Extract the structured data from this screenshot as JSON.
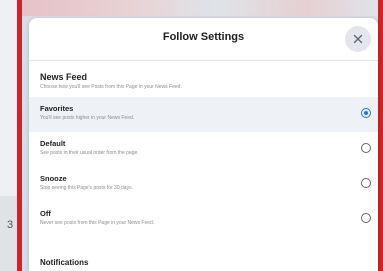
{
  "background": {
    "left_partial_text": "3"
  },
  "dialog": {
    "title": "Follow Settings",
    "close_icon": "close-icon",
    "news_feed": {
      "title": "News Feed",
      "description": "Choose how you'll see Posts from this Page in your News Feed."
    },
    "options": [
      {
        "label": "Favorites",
        "description": "You'll see posts higher in your News Feed.",
        "selected": true
      },
      {
        "label": "Default",
        "description": "See posts in their usual order from the page.",
        "selected": false
      },
      {
        "label": "Snooze",
        "description": "Stop seeing this Page's posts for 30 days.",
        "selected": false
      },
      {
        "label": "Off",
        "description": "Never see posts from this Page in your News Feed.",
        "selected": false
      }
    ],
    "notifications": {
      "title": "Notifications"
    }
  },
  "colors": {
    "frame_red": "#c9252c",
    "accent_blue": "#1877f2",
    "selected_row": "#eef1f5"
  }
}
